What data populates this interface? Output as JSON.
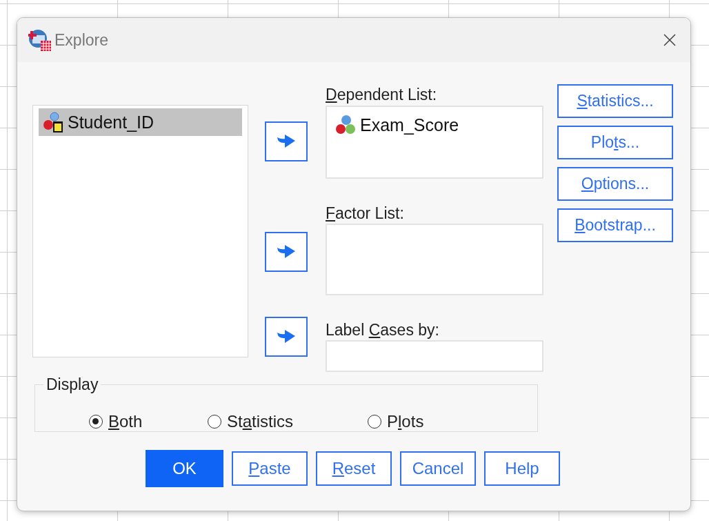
{
  "window": {
    "title": "Explore"
  },
  "source_list": {
    "items": [
      {
        "name": "Student_ID",
        "kind": "nominal",
        "selected": true
      }
    ]
  },
  "dependent_list": {
    "label": {
      "key": "D",
      "post": "ependent List:"
    },
    "items": [
      {
        "name": "Exam_Score",
        "kind": "scale",
        "selected": false
      }
    ]
  },
  "factor_list": {
    "label": {
      "key": "F",
      "post": "actor List:"
    }
  },
  "label_cases": {
    "label": {
      "pre": "Label ",
      "key": "C",
      "post": "ases by:"
    }
  },
  "side_buttons": [
    {
      "key": "S",
      "post": "tatistics..."
    },
    {
      "pre": "Plo",
      "key": "t",
      "post": "s..."
    },
    {
      "key": "O",
      "post": "ptions..."
    },
    {
      "key": "B",
      "post": "ootstrap..."
    }
  ],
  "display": {
    "legend": "Display",
    "options": [
      {
        "label": {
          "key": "B",
          "post": "oth"
        },
        "selected": true
      },
      {
        "label": {
          "pre": "St",
          "key": "a",
          "post": "tistics"
        },
        "selected": false
      },
      {
        "label": {
          "pre": "P",
          "key": "l",
          "post": "ots"
        },
        "selected": false
      }
    ]
  },
  "buttons": [
    {
      "label": {
        "pre": "OK"
      },
      "kind": "default"
    },
    {
      "label": {
        "key": "P",
        "post": "aste"
      },
      "kind": "normal"
    },
    {
      "label": {
        "key": "R",
        "post": "eset"
      },
      "kind": "normal"
    },
    {
      "label": {
        "pre": "Cancel"
      },
      "kind": "normal"
    },
    {
      "label": {
        "pre": "Help"
      },
      "kind": "normal"
    }
  ]
}
